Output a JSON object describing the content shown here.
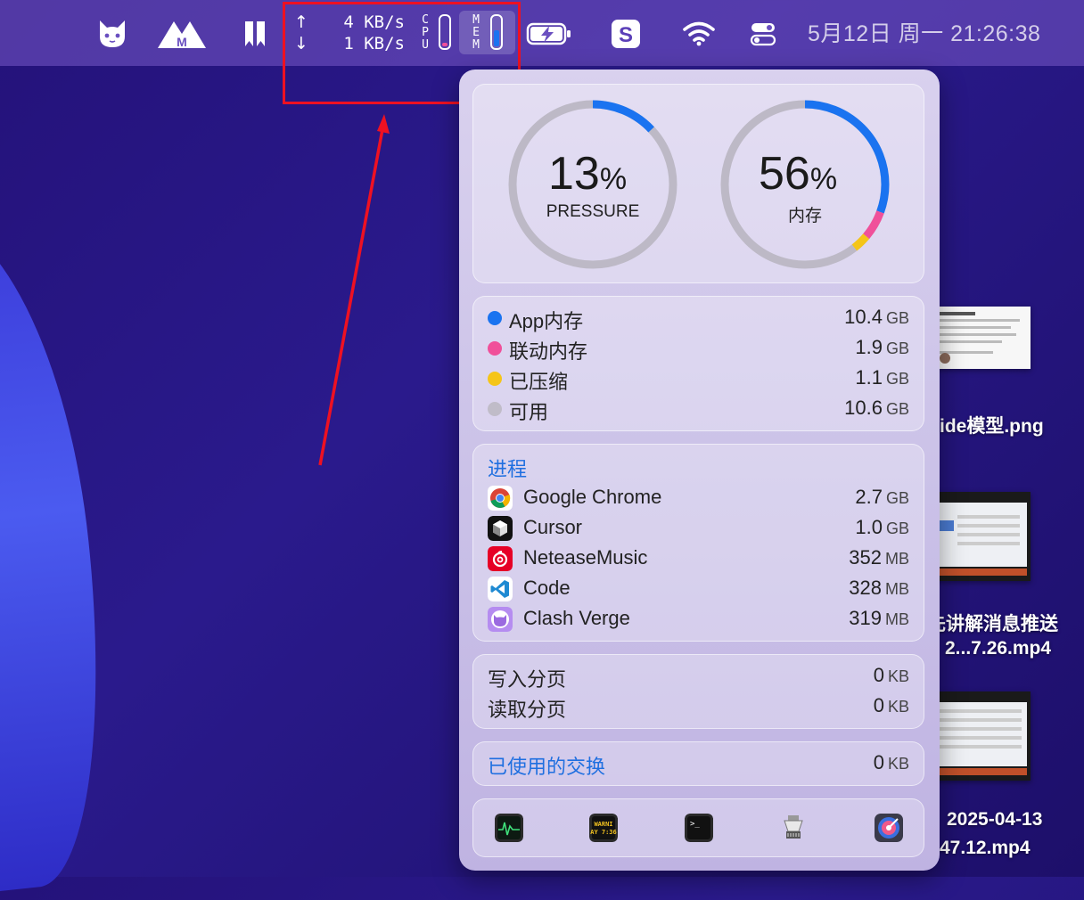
{
  "menubar": {
    "net_up": "4 KB/s",
    "net_down": "1 KB/s",
    "up_arrow": "↑",
    "down_arrow": "↓",
    "cpu_letters": [
      "C",
      "P",
      "U"
    ],
    "mem_letters": [
      "M",
      "E",
      "M"
    ],
    "cpu_level": 0.13,
    "mem_level": 0.56,
    "clock": "5月12日 周一  21:26:38",
    "icons": [
      "cat-icon",
      "m-logo-icon",
      "bookmark-icon",
      "battery-charging-icon",
      "s-app-icon",
      "wifi-icon",
      "control-center-icon"
    ]
  },
  "desktop": {
    "files": [
      {
        "label": "ide模型.png"
      },
      {
        "label": "先讲解消息推送"
      },
      {
        "label": "2...7.26.mp4"
      },
      {
        "label": "2025-04-13"
      },
      {
        "label": "47.12.mp4"
      }
    ]
  },
  "panel": {
    "pressure": {
      "value": "13",
      "pct": "%",
      "label": "PRESSURE",
      "fraction": 0.13
    },
    "memory": {
      "value": "56",
      "pct": "%",
      "label": "内存",
      "segments": [
        {
          "name": "App内存",
          "fraction": 0.3058,
          "color": "#1a73f0"
        },
        {
          "name": "联动内存",
          "fraction": 0.0559,
          "color": "#f0509a"
        },
        {
          "name": "已压缩",
          "fraction": 0.0324,
          "color": "#f5c518"
        }
      ],
      "track_color": "#c0bcc8"
    },
    "breakdown": [
      {
        "name": "App内存",
        "value": "10.4",
        "unit": "GB",
        "color": "#1a73f0"
      },
      {
        "name": "联动内存",
        "value": "1.9",
        "unit": "GB",
        "color": "#f0509a"
      },
      {
        "name": "已压缩",
        "value": "1.1",
        "unit": "GB",
        "color": "#f5c518"
      },
      {
        "name": "可用",
        "value": "10.6",
        "unit": "GB",
        "color": "#c0bcc8"
      }
    ],
    "processes_title": "进程",
    "processes": [
      {
        "name": "Google Chrome",
        "value": "2.7",
        "unit": "GB",
        "icon": "chrome-icon"
      },
      {
        "name": "Cursor",
        "value": "1.0",
        "unit": "GB",
        "icon": "cursor-icon"
      },
      {
        "name": "NeteaseMusic",
        "value": "352",
        "unit": "MB",
        "icon": "netease-music-icon"
      },
      {
        "name": "Code",
        "value": "328",
        "unit": "MB",
        "icon": "vscode-icon"
      },
      {
        "name": "Clash Verge",
        "value": "319",
        "unit": "MB",
        "icon": "clash-verge-icon"
      }
    ],
    "paging": [
      {
        "name": "写入分页",
        "value": "0",
        "unit": "KB"
      },
      {
        "name": "读取分页",
        "value": "0",
        "unit": "KB"
      }
    ],
    "swap": {
      "name": "已使用的交换",
      "value": "0",
      "unit": "KB"
    },
    "dock": {
      "console_text_1": "WARNI",
      "console_text_2": "AY 7:36",
      "terminal_prompt": ">_",
      "icons": [
        "activity-monitor-icon",
        "console-icon",
        "terminal-icon",
        "system-info-icon",
        "disk-utility-icon"
      ]
    }
  }
}
